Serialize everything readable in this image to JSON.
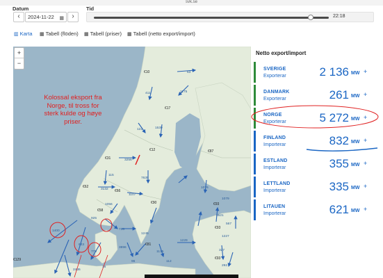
{
  "browser": {
    "url": "svk.se"
  },
  "controls": {
    "date_label": "Datum",
    "date_value": "2024-11-22",
    "time_label": "Tid",
    "time_value": "22:18",
    "time_progress": 0.93
  },
  "tabs": [
    {
      "label": "Karta",
      "active": true,
      "icon": "map-icon"
    },
    {
      "label": "Tabell (flöden)",
      "active": false,
      "icon": "table-icon"
    },
    {
      "label": "Tabell (priser)",
      "active": false,
      "icon": "table-icon"
    },
    {
      "label": "Tabell (netto export/import)",
      "active": false,
      "icon": "table-icon"
    }
  ],
  "map": {
    "zoom_in": "+",
    "zoom_out": "−",
    "annotation": "Kolossal eksport fra Norge, til tross for sterk kulde og høye priser.",
    "colors": {
      "sea": "#9bb6c8",
      "land": "#e4ecdc",
      "flow": "#2a63b5",
      "annotation": "#e02020"
    },
    "price_labels": [
      "€10",
      "€17",
      "€12",
      "€31",
      "€87",
      "€62",
      "€58",
      "€66",
      "€90",
      "€93",
      "€93",
      "€93",
      "€81",
      "€129"
    ],
    "flow_labels": [
      "63",
      "411",
      "1175",
      "122",
      "1539",
      "3256",
      "115",
      "7635",
      "1076",
      "3132",
      "1107",
      "1056",
      "925",
      "735",
      "1400",
      "643",
      "778",
      "2436",
      "3896",
      "1245",
      "1135",
      "1229",
      "1079",
      "567",
      "3521",
      "1227",
      "327",
      "292",
      "112",
      "96",
      "16"
    ]
  },
  "sidebar": {
    "title": "Netto export/import",
    "unit": "MW",
    "plus": "+",
    "countries": [
      {
        "name": "SVERIGE",
        "status": "Exporterar",
        "value": "2 136",
        "bar_color": "#2e8b3a"
      },
      {
        "name": "DANMARK",
        "status": "Exporterar",
        "value": "261",
        "bar_color": "#2e8b3a"
      },
      {
        "name": "NORGE",
        "status": "Exporterar",
        "value": "5 272",
        "bar_color": "#2e8b3a"
      },
      {
        "name": "FINLAND",
        "status": "Importerar",
        "value": "832",
        "bar_color": "#1a66c4"
      },
      {
        "name": "ESTLAND",
        "status": "Importerar",
        "value": "355",
        "bar_color": "#1a66c4"
      },
      {
        "name": "LETTLAND",
        "status": "Importerar",
        "value": "335",
        "bar_color": "#1a66c4"
      },
      {
        "name": "LITAUEN",
        "status": "Importerar",
        "value": "621",
        "bar_color": "#1a66c4"
      }
    ]
  }
}
